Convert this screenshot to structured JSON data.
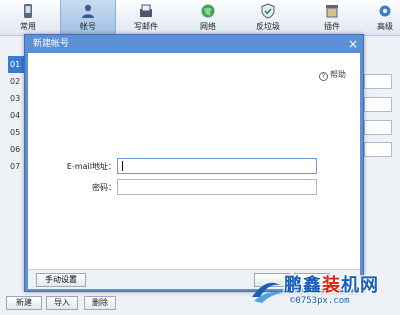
{
  "toolbar": {
    "items": [
      {
        "label": "常用",
        "icon": "phone-icon"
      },
      {
        "label": "帐号",
        "icon": "user-icon"
      },
      {
        "label": "写邮件",
        "icon": "compose-icon"
      },
      {
        "label": "网络",
        "icon": "globe-icon"
      },
      {
        "label": "反垃圾",
        "icon": "shield-icon"
      },
      {
        "label": "插件",
        "icon": "plugin-icon"
      },
      {
        "label": "高级",
        "icon": "gear-icon"
      }
    ],
    "active_index": 1
  },
  "background": {
    "list_rows": [
      "01",
      "02",
      "03",
      "04",
      "05",
      "06",
      "07"
    ],
    "buttons": {
      "new": "新建",
      "import": "导入",
      "delete": "删除"
    }
  },
  "dialog": {
    "title": "新建帐号",
    "close": "×",
    "help": {
      "icon": "?",
      "label": "帮助"
    },
    "email_label": "E-mail地址：",
    "email_value": "",
    "password_label": "密码：",
    "password_value": "",
    "manual_setup": "手动设置"
  },
  "watermark": {
    "brand_blue": "鹏鑫",
    "brand_red": "装",
    "brand_blue2": "机网",
    "url": "©0753px.com"
  },
  "colors": {
    "title_bar": "#5b8fd6",
    "selection": "#3a7bd5",
    "brand": "#1a5fb4",
    "brand_red": "#d8261d"
  }
}
